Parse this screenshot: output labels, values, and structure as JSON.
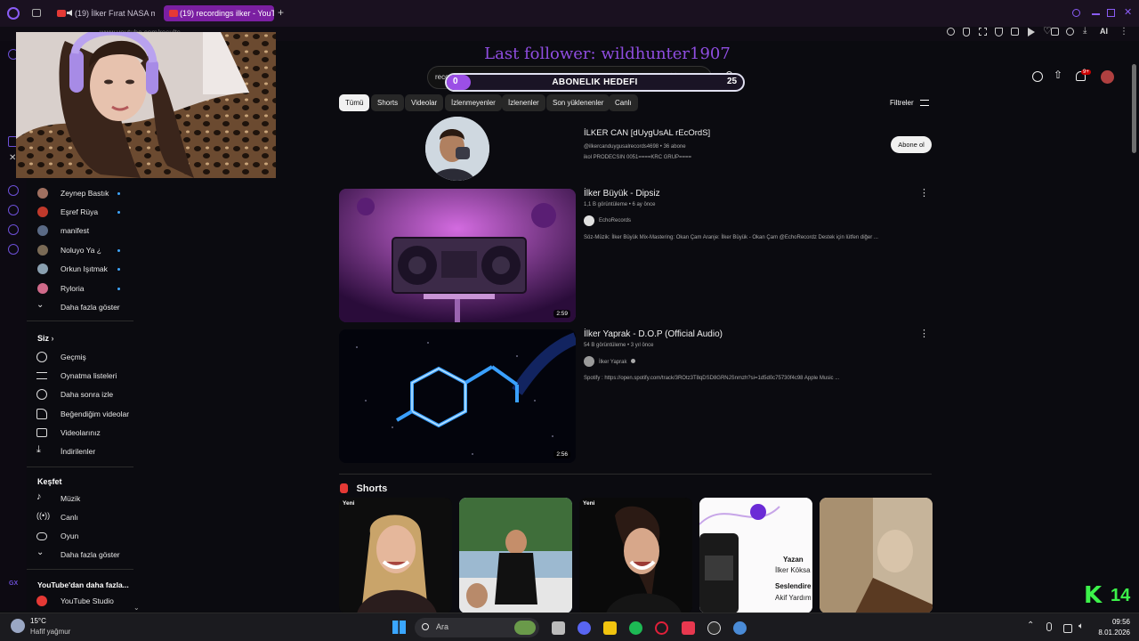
{
  "browser": {
    "tabs": [
      {
        "label": "(19) İlker Fırat NASA m"
      },
      {
        "label": "(19) recordings ilker - YouT"
      }
    ],
    "new_tab": "+",
    "url": "www.youtube.com/results",
    "toolbar_ai": "AI"
  },
  "overlay": {
    "last_follower": "Last follower: wildhunter1907",
    "goal_label": "ABONELIK HEDEFI",
    "goal_current": "0",
    "goal_target": "25",
    "goal_progress": 0.05,
    "corner_badge": "14"
  },
  "search": {
    "query": "recordings ilker"
  },
  "header": {
    "notif_badge": "9+"
  },
  "sidebar": {
    "subscriptions": [
      "Zeynep Bastık",
      "Eşref Rüya",
      "manifest",
      "Noluyo Ya ¿",
      "Orkun Işıtmak",
      "Ryloria"
    ],
    "show_more": "Daha fazla göster",
    "you_heading": "Siz",
    "you_items": [
      "Geçmiş",
      "Oynatma listeleri",
      "Daha sonra izle",
      "Beğendiğim videolar",
      "Videolarınız",
      "İndirilenler"
    ],
    "explore_heading": "Keşfet",
    "explore_items": [
      "Müzik",
      "Canlı",
      "Oyun"
    ],
    "explore_more": "Daha fazla göster",
    "more_heading": "YouTube'dan daha fazla...",
    "studio": "YouTube Studio"
  },
  "filters": {
    "chips": [
      "Tümü",
      "Shorts",
      "Videolar",
      "İzlenmeyenler",
      "İzlenenler",
      "Son yüklenenler",
      "Canlı"
    ],
    "filter_label": "Filtreler"
  },
  "channel": {
    "name": "İLKER CAN [dUygUsAL rEcOrdS]",
    "handle_subs": "@ilkercanduygusalrecords4698 • 36 abone",
    "desc": "ikol PRODECSIN 0051====KRC GRUP====",
    "subscribe": "Abone ol"
  },
  "videos": [
    {
      "title": "İlker Büyük - Dipsiz",
      "meta": "1,1 B görüntüleme • 6 ay önce",
      "channel": "EchoRecords",
      "desc": "Söz-Müzik: İlker Büyük Mix-Mastering: Okan Çam Aranje: İlker Büyük - Okan Çam @EchoRecordz Destek için lütfen diğer ...",
      "duration": "2:59"
    },
    {
      "title": "İlker Yaprak - D.O.P (Official Audio)",
      "meta": "54 B görüntüleme • 3 yıl önce",
      "channel": "İlker Yaprak",
      "desc": "Spotify : https://open.spotify.com/track/3ROtz3T8qDSD8GRNJSnmzh?si=1d5d0c75730f4c98 Apple Music ...",
      "duration": "2:56"
    }
  ],
  "shorts": {
    "heading": "Shorts",
    "badge": "Yeni",
    "card4": {
      "line1": "Yazan",
      "line2": "İlker Köksa",
      "line3": "Seslendire",
      "line4": "Akif Yardım"
    }
  },
  "taskbar": {
    "weather_temp": "15°C",
    "weather_desc": "Hafif yağmur",
    "search": "Ara",
    "time": "09:56",
    "date": "8.01.2026"
  }
}
